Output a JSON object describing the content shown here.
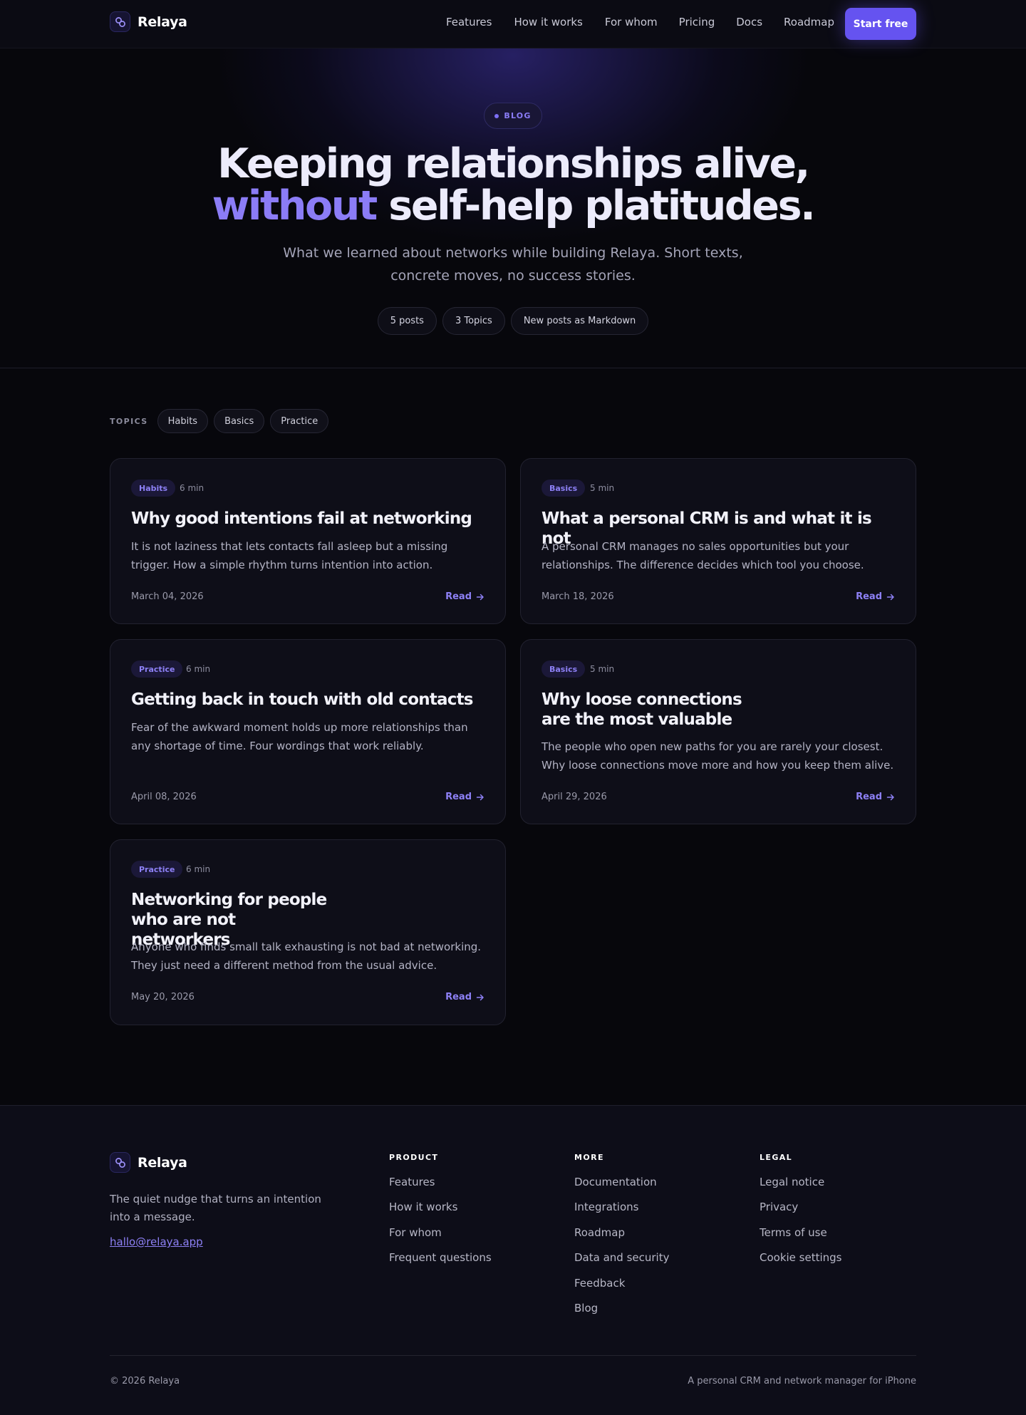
{
  "nav": {
    "brand": "Relaya",
    "links": [
      "Features",
      "How it works",
      "For whom",
      "Pricing",
      "Docs",
      "Roadmap"
    ],
    "cta": "Start free"
  },
  "hero": {
    "badge": "BLOG",
    "title_line1": "Keeping relationships alive,",
    "title_accent": "without",
    "title_line2_rest": " self-help platitudes.",
    "subtitle_line1": "What we learned about networks while building Relaya. Short texts,",
    "subtitle_line2": "concrete moves, no success stories.",
    "stats": [
      "5 posts",
      "3 Topics",
      "New posts as Markdown"
    ]
  },
  "topics": {
    "label": "TOPICS",
    "items": [
      "Habits",
      "Basics",
      "Practice"
    ]
  },
  "posts": [
    {
      "tag": "Habits",
      "minutes": "6 min",
      "title": "Why good intentions fail at networking",
      "excerpt": "It is not laziness that lets contacts fall asleep but a missing trigger. How a simple rhythm turns intention into action.",
      "date": "March 04, 2026",
      "read": "Read"
    },
    {
      "tag": "Basics",
      "minutes": "5 min",
      "title": "What a personal CRM is and what it is not",
      "excerpt": "A personal CRM manages no sales opportunities but your relationships. The difference decides which tool you choose.",
      "date": "March 18, 2026",
      "read": "Read"
    },
    {
      "tag": "Practice",
      "minutes": "6 min",
      "title": "Getting back in touch with old contacts",
      "excerpt": "Fear of the awkward moment holds up more relationships than any shortage of time. Four wordings that work reliably.",
      "date": "April 08, 2026",
      "read": "Read"
    },
    {
      "tag": "Basics",
      "minutes": "5 min",
      "title": "Why loose connections are the most valuable",
      "excerpt": "The people who open new paths for you are rarely your closest. Why loose connections move more and how you keep them alive.",
      "date": "April 29, 2026",
      "read": "Read"
    },
    {
      "tag": "Practice",
      "minutes": "6 min",
      "title": "Networking for people who are not networkers",
      "excerpt": "Anyone who finds small talk exhausting is not bad at networking. They just need a different method from the usual advice.",
      "date": "May 20, 2026",
      "read": "Read"
    }
  ],
  "footer": {
    "brand": "Relaya",
    "tagline": "The quiet nudge that turns an intention into a message.",
    "email": "hallo@relaya.app",
    "columns": [
      {
        "heading": "PRODUCT",
        "links": [
          "Features",
          "How it works",
          "For whom",
          "Frequent questions"
        ]
      },
      {
        "heading": "MORE",
        "links": [
          "Documentation",
          "Integrations",
          "Roadmap",
          "Data and security",
          "Feedback",
          "Blog"
        ]
      },
      {
        "heading": "LEGAL",
        "links": [
          "Legal notice",
          "Privacy",
          "Terms of use",
          "Cookie settings"
        ]
      }
    ],
    "copyright": "© 2026 Relaya",
    "bottom_tagline": "A personal CRM and network manager for iPhone"
  },
  "colors": {
    "accent": "#6553f0",
    "accent_text": "#8b7cf6",
    "background": "#07070c",
    "card": "#0e0e18"
  },
  "icons": [
    "relaya-logo-icon",
    "arrow-right-icon"
  ]
}
